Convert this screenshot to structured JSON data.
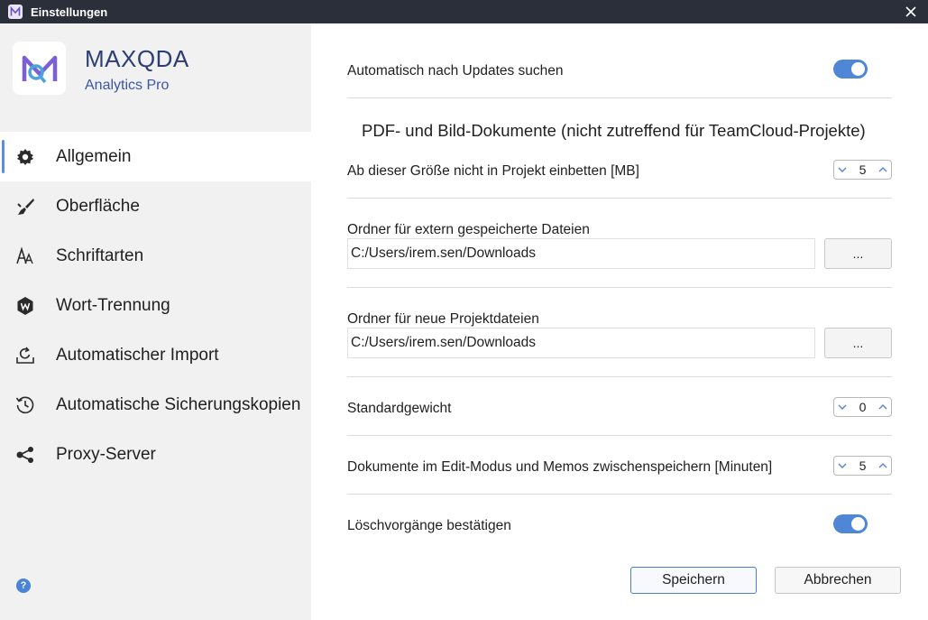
{
  "window": {
    "title": "Einstellungen",
    "app_icon": "maxqda-icon",
    "close_icon": "close-icon"
  },
  "brand": {
    "name": "MAXQDA",
    "edition": "Analytics Pro",
    "colors": {
      "name": "#2c3e74",
      "edition": "#3a56a5"
    }
  },
  "sidebar": {
    "items": [
      {
        "label": "Allgemein",
        "icon": "gear-icon",
        "active": true
      },
      {
        "label": "Oberfläche",
        "icon": "paint-brush-icon",
        "active": false
      },
      {
        "label": "Schriftarten",
        "icon": "font-icon",
        "active": false
      },
      {
        "label": "Wort-Trennung",
        "icon": "hyphenation-icon",
        "active": false
      },
      {
        "label": "Automatischer Import",
        "icon": "import-icon",
        "active": false
      },
      {
        "label": "Automatische Sicherungskopien",
        "icon": "history-icon",
        "active": false
      },
      {
        "label": "Proxy-Server",
        "icon": "share-icon",
        "active": false
      }
    ],
    "help_label": "?"
  },
  "settings": {
    "auto_updates": {
      "label": "Automatisch nach Updates suchen",
      "enabled": true
    },
    "section_title": "PDF- und Bild-Dokumente (nicht zutreffend für TeamCloud-Projekte)",
    "embed_size": {
      "label": "Ab dieser Größe nicht in Projekt einbetten [MB]",
      "value": "5"
    },
    "external_folder": {
      "label": "Ordner für extern gespeicherte Dateien",
      "value": "C:/Users/irem.sen/Downloads",
      "browse_label": "..."
    },
    "project_folder": {
      "label": "Ordner für neue Projektdateien",
      "value": "C:/Users/irem.sen/Downloads",
      "browse_label": "..."
    },
    "default_weight": {
      "label": "Standardgewicht",
      "value": "0"
    },
    "autosave": {
      "label": "Dokumente im Edit-Modus und Memos zwischenspeichern [Minuten]",
      "value": "5"
    },
    "confirm_delete": {
      "label": "Löschvorgänge bestätigen",
      "enabled": true
    }
  },
  "buttons": {
    "save": "Speichern",
    "cancel": "Abbrechen"
  },
  "colors": {
    "accent": "#4f86d6",
    "titlebar": "#2b2f3a",
    "sidebar": "#f1f1f1"
  }
}
